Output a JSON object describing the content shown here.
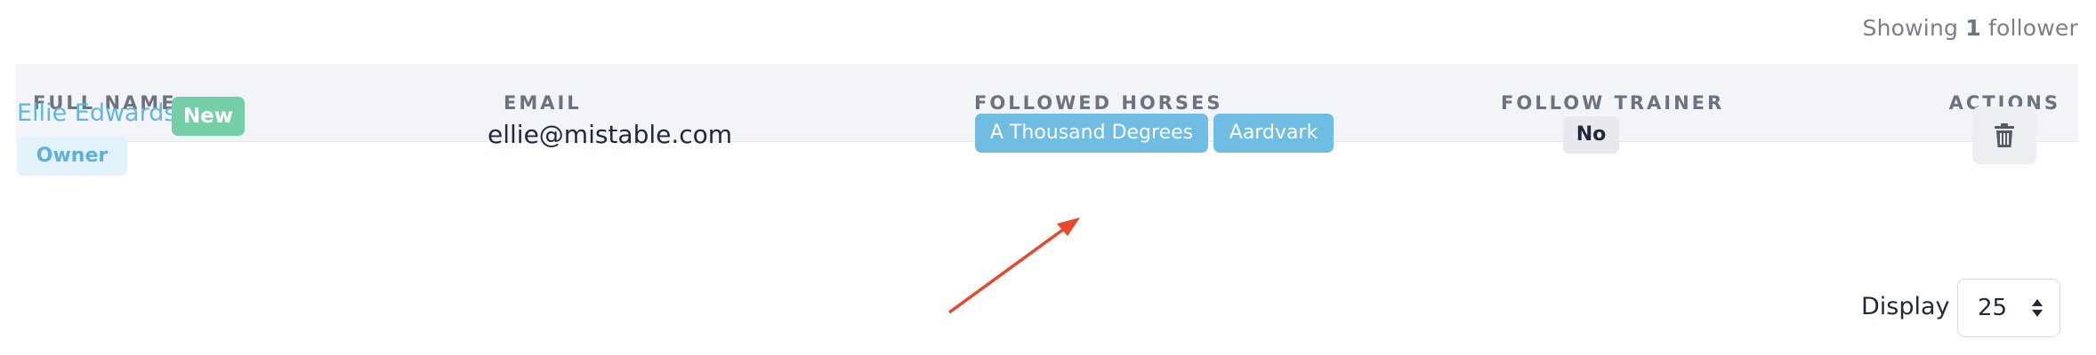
{
  "summary": {
    "prefix": "Showing",
    "count": "1",
    "suffix": "follower"
  },
  "table": {
    "columns": {
      "full_name": "FULL NAME",
      "email": "EMAIL",
      "followed_horses": "FOLLOWED HORSES",
      "follow_trainer": "FOLLOW TRAINER",
      "actions": "ACTIONS"
    },
    "rows": [
      {
        "name": "Ellie Edwards",
        "badge": "New",
        "role": "Owner",
        "email": "ellie@mistable.com",
        "horses": [
          "A Thousand Degrees",
          "Aardvark"
        ],
        "follow_trainer": "No",
        "delete_icon": "trash-icon"
      }
    ]
  },
  "pagination": {
    "display_label": "Display",
    "page_size": "25"
  },
  "colors": {
    "link": "#5fb8e0",
    "badge_new": "#74cfa7",
    "badge_owner_bg": "#e3f3fb",
    "horse_tag": "#6fbde3",
    "annotation_arrow": "#e8492e"
  }
}
